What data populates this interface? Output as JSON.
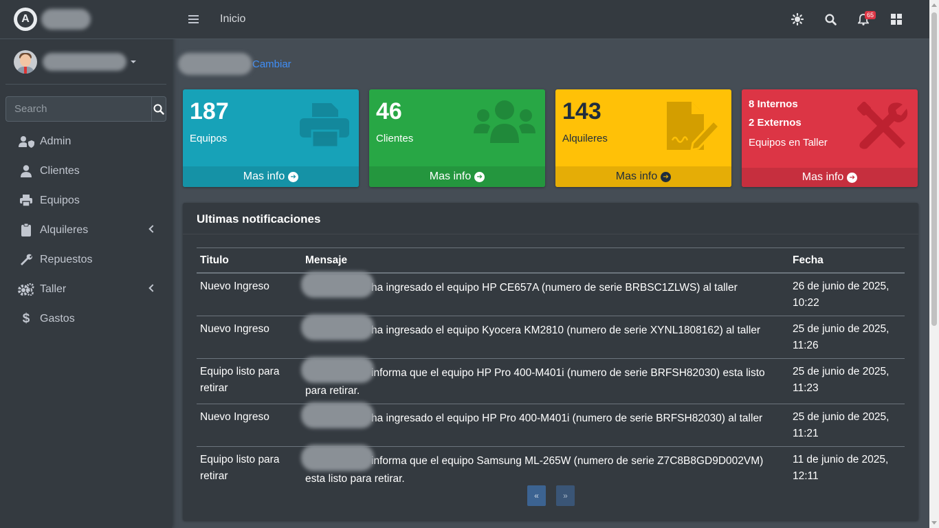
{
  "navbar": {
    "home_label": "Inicio",
    "notification_count": "65"
  },
  "sidebar": {
    "search_placeholder": "Search",
    "items": [
      {
        "label": "Admin"
      },
      {
        "label": "Clientes"
      },
      {
        "label": "Equipos"
      },
      {
        "label": "Alquileres"
      },
      {
        "label": "Repuestos"
      },
      {
        "label": "Taller"
      },
      {
        "label": "Gastos"
      }
    ]
  },
  "company": {
    "change_label": "Cambiar"
  },
  "boxes": [
    {
      "value": "187",
      "label": "Equipos",
      "footer": "Mas info",
      "color": "#17a2b8",
      "icon": "printer-icon"
    },
    {
      "value": "46",
      "label": "Clientes",
      "footer": "Mas info",
      "color": "#28a745",
      "icon": "users-icon"
    },
    {
      "value": "143",
      "label": "Alquileres",
      "footer": "Mas info",
      "color": "#ffc107",
      "icon": "contract-icon"
    },
    {
      "line1": "8 Internos",
      "line2": "2 Externos",
      "label": "Equipos en Taller",
      "footer": "Mas info",
      "color": "#dc3545",
      "icon": "tools-icon"
    }
  ],
  "notifications": {
    "title": "Ultimas notificaciones",
    "columns": [
      "Titulo",
      "Mensaje",
      "Fecha"
    ],
    "rows": [
      {
        "titulo": "Nuevo Ingreso",
        "mensaje": "ha ingresado el equipo HP CE657A (numero de serie BRBSC1ZLWS) al taller",
        "fecha": "26 de junio de 2025, 10:22"
      },
      {
        "titulo": "Nuevo Ingreso",
        "mensaje": "ha ingresado el equipo Kyocera KM2810 (numero de serie XYNL1808162) al taller",
        "fecha": "25 de junio de 2025, 11:26"
      },
      {
        "titulo": "Equipo listo para retirar",
        "mensaje": "informa que el equipo HP Pro 400-M401i (numero de serie BRFSH82030) esta listo para retirar.",
        "fecha": "25 de junio de 2025, 11:23"
      },
      {
        "titulo": "Nuevo Ingreso",
        "mensaje": "ha ingresado el equipo HP Pro 400-M401i (numero de serie BRFSH82030) al taller",
        "fecha": "25 de junio de 2025, 11:21"
      },
      {
        "titulo": "Equipo listo para retirar",
        "mensaje": "informa que el equipo Samsung ML-265W (numero de serie Z7C8B8GD9D002VM) esta listo para retirar.",
        "fecha": "11 de junio de 2025, 12:11"
      }
    ],
    "pager": {
      "prev": "«",
      "next": "»"
    }
  }
}
